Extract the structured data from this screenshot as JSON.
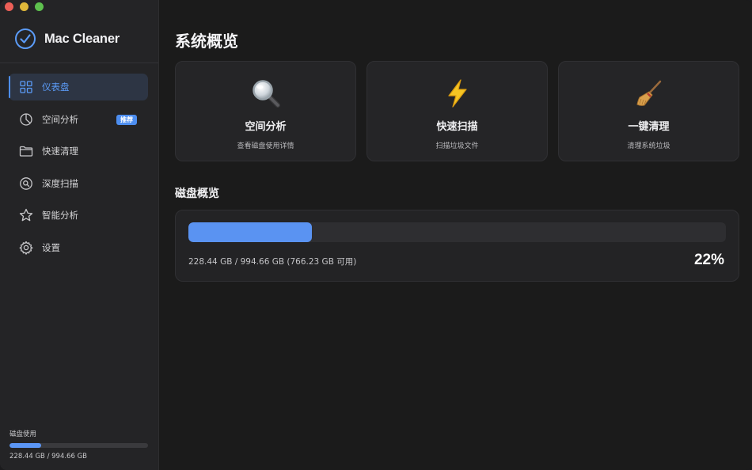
{
  "window": {
    "controls": [
      "close",
      "minimize",
      "zoom"
    ]
  },
  "sidebar": {
    "app_name": "Mac Cleaner",
    "logo_icon": "checkmark-circle-icon",
    "items": [
      {
        "label": "仪表盘",
        "icon": "grid-icon",
        "active": true
      },
      {
        "label": "空间分析",
        "icon": "pie-chart-icon",
        "badge": "推荐"
      },
      {
        "label": "快速清理",
        "icon": "folder-icon"
      },
      {
        "label": "深度扫描",
        "icon": "magnifier-circle-icon"
      },
      {
        "label": "智能分析",
        "icon": "star-icon"
      },
      {
        "label": "设置",
        "icon": "gear-icon"
      }
    ],
    "usage": {
      "label": "磁盘使用",
      "text": "228.44 GB / 994.66 GB",
      "fraction": 0.23
    }
  },
  "main": {
    "title": "系统概览",
    "cards": [
      {
        "title": "空间分析",
        "desc": "查看磁盘使用详情",
        "icon": "magnifying-glass-icon"
      },
      {
        "title": "快速扫描",
        "desc": "扫描垃圾文件",
        "icon": "lightning-icon"
      },
      {
        "title": "一键清理",
        "desc": "清理系统垃圾",
        "icon": "broom-icon"
      }
    ],
    "disk": {
      "section_title": "磁盘概览",
      "usage_text": "228.44 GB / 994.66 GB (766.23 GB 可用)",
      "percent_text": "22%",
      "percent": 23
    }
  },
  "colors": {
    "accent": "#4d8ef0",
    "bar_fill": "#5a93f2",
    "background": "#1b1b1b",
    "sidebar_bg": "#242426"
  }
}
